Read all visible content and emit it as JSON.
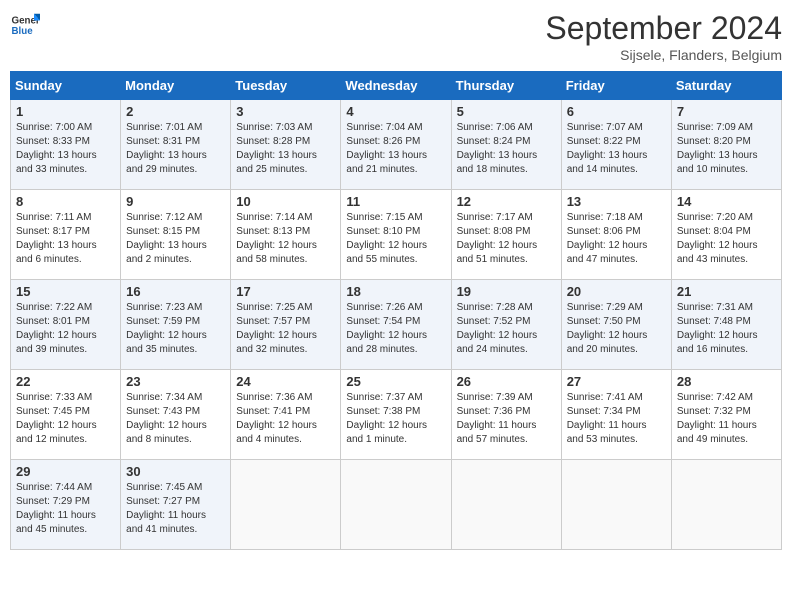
{
  "logo": {
    "text_general": "General",
    "text_blue": "Blue"
  },
  "title": "September 2024",
  "subtitle": "Sijsele, Flanders, Belgium",
  "days_of_week": [
    "Sunday",
    "Monday",
    "Tuesday",
    "Wednesday",
    "Thursday",
    "Friday",
    "Saturday"
  ],
  "weeks": [
    [
      {
        "day": 1,
        "sunrise": "7:00 AM",
        "sunset": "8:33 PM",
        "daylight": "13 hours and 33 minutes."
      },
      {
        "day": 2,
        "sunrise": "7:01 AM",
        "sunset": "8:31 PM",
        "daylight": "13 hours and 29 minutes."
      },
      {
        "day": 3,
        "sunrise": "7:03 AM",
        "sunset": "8:28 PM",
        "daylight": "13 hours and 25 minutes."
      },
      {
        "day": 4,
        "sunrise": "7:04 AM",
        "sunset": "8:26 PM",
        "daylight": "13 hours and 21 minutes."
      },
      {
        "day": 5,
        "sunrise": "7:06 AM",
        "sunset": "8:24 PM",
        "daylight": "13 hours and 18 minutes."
      },
      {
        "day": 6,
        "sunrise": "7:07 AM",
        "sunset": "8:22 PM",
        "daylight": "13 hours and 14 minutes."
      },
      {
        "day": 7,
        "sunrise": "7:09 AM",
        "sunset": "8:20 PM",
        "daylight": "13 hours and 10 minutes."
      }
    ],
    [
      {
        "day": 8,
        "sunrise": "7:11 AM",
        "sunset": "8:17 PM",
        "daylight": "13 hours and 6 minutes."
      },
      {
        "day": 9,
        "sunrise": "7:12 AM",
        "sunset": "8:15 PM",
        "daylight": "13 hours and 2 minutes."
      },
      {
        "day": 10,
        "sunrise": "7:14 AM",
        "sunset": "8:13 PM",
        "daylight": "12 hours and 58 minutes."
      },
      {
        "day": 11,
        "sunrise": "7:15 AM",
        "sunset": "8:10 PM",
        "daylight": "12 hours and 55 minutes."
      },
      {
        "day": 12,
        "sunrise": "7:17 AM",
        "sunset": "8:08 PM",
        "daylight": "12 hours and 51 minutes."
      },
      {
        "day": 13,
        "sunrise": "7:18 AM",
        "sunset": "8:06 PM",
        "daylight": "12 hours and 47 minutes."
      },
      {
        "day": 14,
        "sunrise": "7:20 AM",
        "sunset": "8:04 PM",
        "daylight": "12 hours and 43 minutes."
      }
    ],
    [
      {
        "day": 15,
        "sunrise": "7:22 AM",
        "sunset": "8:01 PM",
        "daylight": "12 hours and 39 minutes."
      },
      {
        "day": 16,
        "sunrise": "7:23 AM",
        "sunset": "7:59 PM",
        "daylight": "12 hours and 35 minutes."
      },
      {
        "day": 17,
        "sunrise": "7:25 AM",
        "sunset": "7:57 PM",
        "daylight": "12 hours and 32 minutes."
      },
      {
        "day": 18,
        "sunrise": "7:26 AM",
        "sunset": "7:54 PM",
        "daylight": "12 hours and 28 minutes."
      },
      {
        "day": 19,
        "sunrise": "7:28 AM",
        "sunset": "7:52 PM",
        "daylight": "12 hours and 24 minutes."
      },
      {
        "day": 20,
        "sunrise": "7:29 AM",
        "sunset": "7:50 PM",
        "daylight": "12 hours and 20 minutes."
      },
      {
        "day": 21,
        "sunrise": "7:31 AM",
        "sunset": "7:48 PM",
        "daylight": "12 hours and 16 minutes."
      }
    ],
    [
      {
        "day": 22,
        "sunrise": "7:33 AM",
        "sunset": "7:45 PM",
        "daylight": "12 hours and 12 minutes."
      },
      {
        "day": 23,
        "sunrise": "7:34 AM",
        "sunset": "7:43 PM",
        "daylight": "12 hours and 8 minutes."
      },
      {
        "day": 24,
        "sunrise": "7:36 AM",
        "sunset": "7:41 PM",
        "daylight": "12 hours and 4 minutes."
      },
      {
        "day": 25,
        "sunrise": "7:37 AM",
        "sunset": "7:38 PM",
        "daylight": "12 hours and 1 minute."
      },
      {
        "day": 26,
        "sunrise": "7:39 AM",
        "sunset": "7:36 PM",
        "daylight": "11 hours and 57 minutes."
      },
      {
        "day": 27,
        "sunrise": "7:41 AM",
        "sunset": "7:34 PM",
        "daylight": "11 hours and 53 minutes."
      },
      {
        "day": 28,
        "sunrise": "7:42 AM",
        "sunset": "7:32 PM",
        "daylight": "11 hours and 49 minutes."
      }
    ],
    [
      {
        "day": 29,
        "sunrise": "7:44 AM",
        "sunset": "7:29 PM",
        "daylight": "11 hours and 45 minutes."
      },
      {
        "day": 30,
        "sunrise": "7:45 AM",
        "sunset": "7:27 PM",
        "daylight": "11 hours and 41 minutes."
      },
      null,
      null,
      null,
      null,
      null
    ]
  ],
  "labels": {
    "sunrise": "Sunrise:",
    "sunset": "Sunset:",
    "daylight": "Daylight:"
  }
}
